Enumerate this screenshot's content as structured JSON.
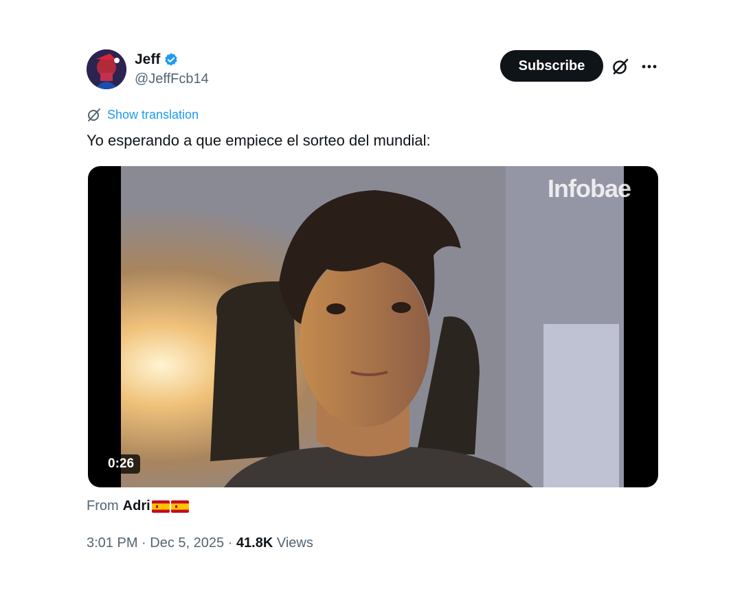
{
  "user": {
    "display_name": "Jeff",
    "handle": "@JeffFcb14",
    "verified_icon": "verified-badge-icon"
  },
  "actions": {
    "subscribe_label": "Subscribe",
    "grok_icon": "grok-icon",
    "more_icon": "more-icon"
  },
  "tweet": {
    "show_translation": "Show translation",
    "text": "Yo esperando a que empiece el sorteo del mundial:"
  },
  "media": {
    "watermark": "Infobae",
    "duration": "0:26"
  },
  "from": {
    "prefix": "From",
    "name": "Adri",
    "flags": [
      "spain-flag-icon",
      "spain-flag-icon"
    ]
  },
  "meta": {
    "time": "3:01 PM",
    "separator": "·",
    "date": "Dec 5, 2025",
    "views_count": "41.8K",
    "views_label": "Views"
  },
  "colors": {
    "accent": "#1d9bf0",
    "text": "#0f1419",
    "muted": "#536471",
    "button": "#0f1419"
  }
}
